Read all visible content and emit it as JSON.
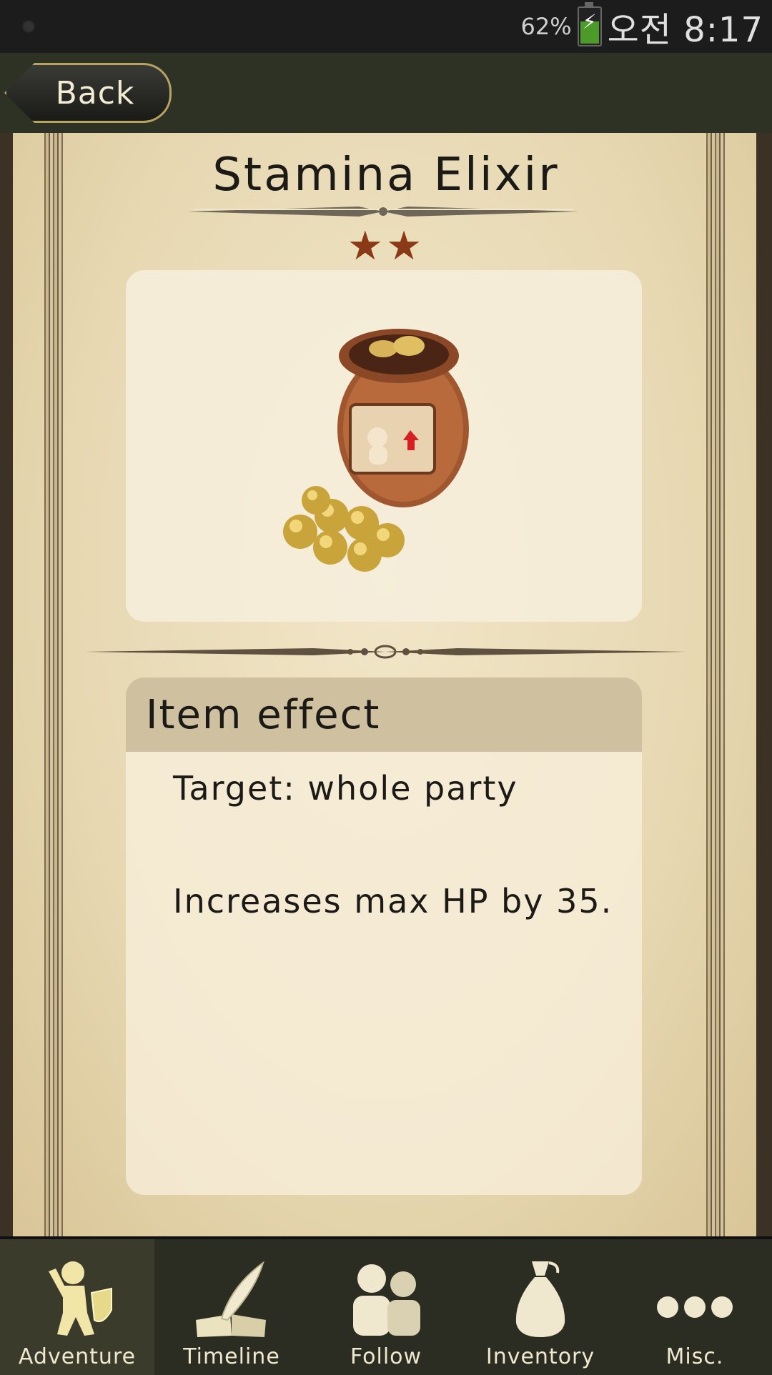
{
  "status_bar": {
    "battery_percent": "62%",
    "clock": "오전 8:17"
  },
  "header": {
    "back_label": "Back"
  },
  "item": {
    "name": "Stamina Elixir",
    "stars": "★★",
    "effect_heading": "Item effect",
    "target_text": "Target: whole party",
    "effect_text": "Increases max HP by 35."
  },
  "nav": {
    "items": [
      {
        "label": "Adventure",
        "icon": "adventurer-icon",
        "active": true
      },
      {
        "label": "Timeline",
        "icon": "quill-book-icon",
        "active": false
      },
      {
        "label": "Follow",
        "icon": "people-icon",
        "active": false
      },
      {
        "label": "Inventory",
        "icon": "sack-icon",
        "active": false
      },
      {
        "label": "Misc.",
        "icon": "more-dots-icon",
        "active": false
      }
    ]
  },
  "colors": {
    "star": "#8a3a16",
    "nav_bg": "#2c2d22",
    "parchment": "#e7d8b2"
  }
}
